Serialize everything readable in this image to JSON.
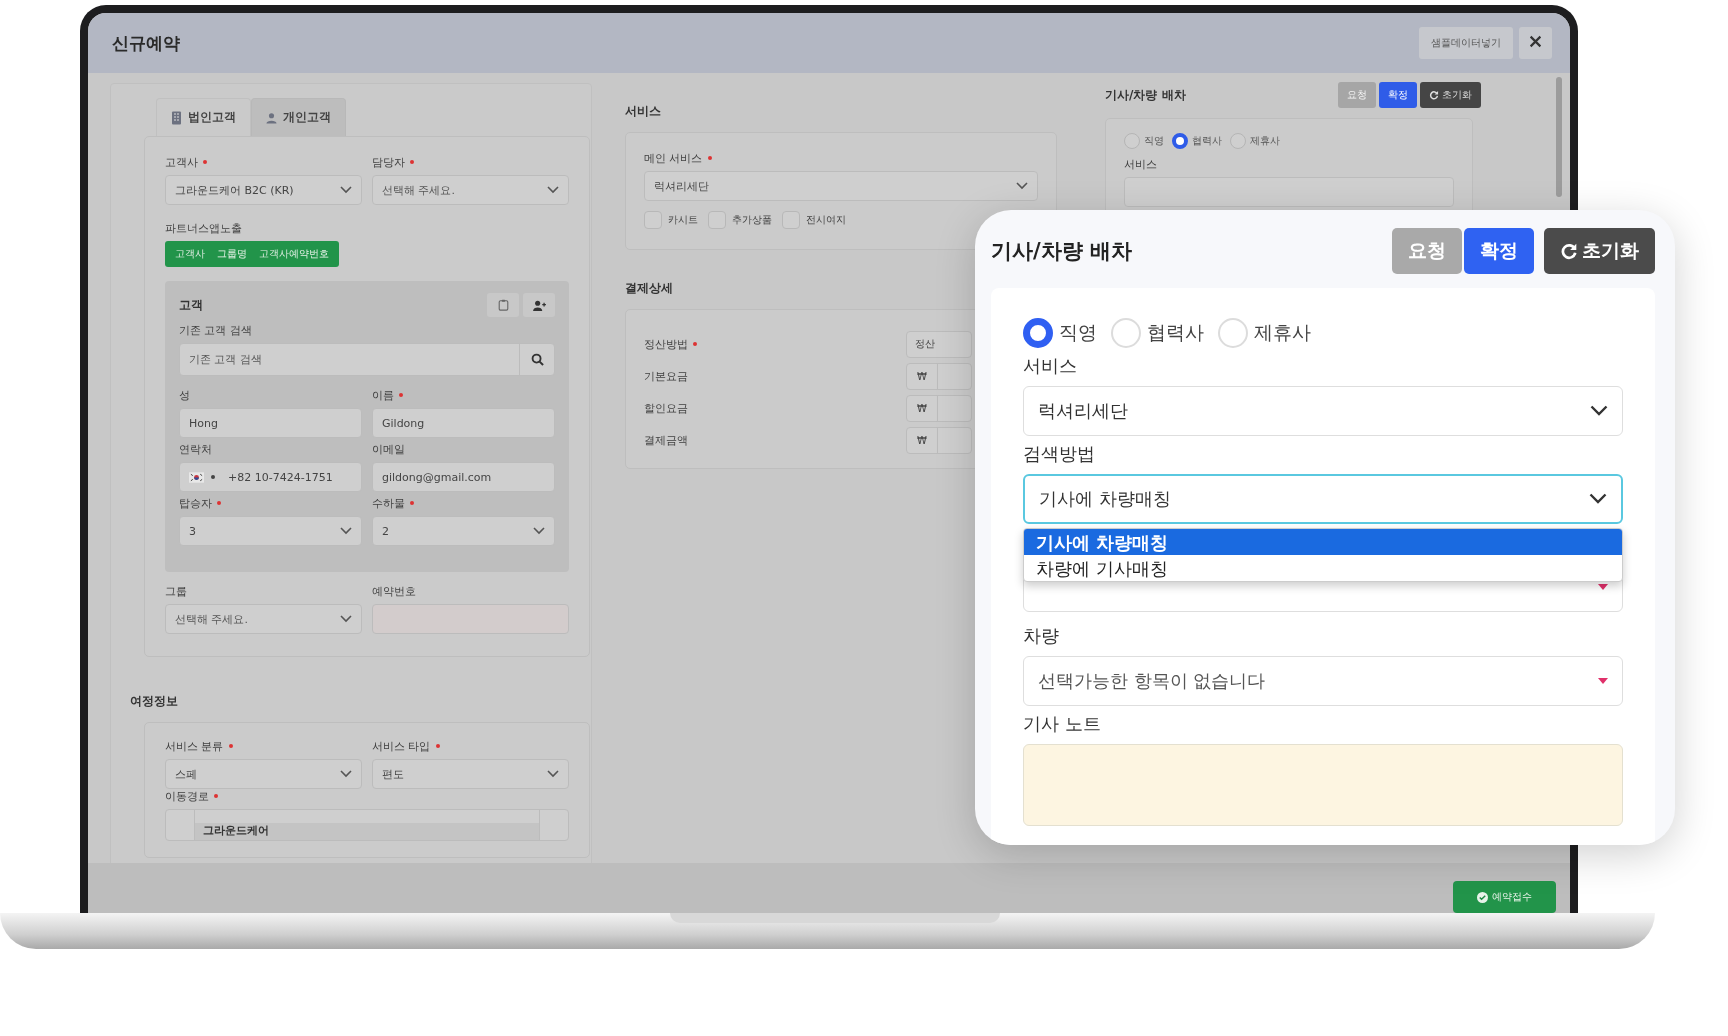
{
  "window": {
    "title": "신규예약",
    "sample_button": "샘플데이터넣기"
  },
  "customer": {
    "tabs": [
      {
        "label": "법인고객",
        "selected": true
      },
      {
        "label": "개인고객",
        "selected": false
      }
    ],
    "fields": [
      {
        "label": "고객사",
        "required": true,
        "kind": "select",
        "value": "그라운드케어 B2C (KR)"
      },
      {
        "label": "담당자",
        "required": true,
        "kind": "select",
        "placeholder": "선택해 주세요."
      }
    ],
    "partner_label": "파트너스앱노출",
    "partner_tags": [
      "고객사",
      "그룹명",
      "고객사예약번호"
    ],
    "customer_box": {
      "title": "고객",
      "search_label": "기존 고객 검색",
      "search_placeholder": "기존 고객 검색",
      "fields": [
        {
          "label": "성",
          "required": false,
          "kind": "input",
          "value": "Hong"
        },
        {
          "label": "이름",
          "required": true,
          "kind": "input",
          "value": "Gildong"
        },
        {
          "label": "연락처",
          "required": false,
          "kind": "phone",
          "value": "+82 10-7424-1751"
        },
        {
          "label": "이메일",
          "required": false,
          "kind": "input",
          "value": "gildong@gmail.com"
        },
        {
          "label": "탑승자",
          "required": true,
          "kind": "select",
          "value": "3"
        },
        {
          "label": "수하물",
          "required": true,
          "kind": "select",
          "value": "2"
        }
      ]
    },
    "extra_fields": [
      {
        "label": "그룹",
        "required": false,
        "kind": "select",
        "placeholder": "선택해 주세요."
      },
      {
        "label": "예약번호",
        "required": false,
        "kind": "readonly"
      }
    ]
  },
  "itinerary": {
    "title": "여정정보",
    "fields": [
      {
        "label": "서비스 분류",
        "required": true,
        "kind": "select",
        "value": "스페"
      },
      {
        "label": "서비스 타입",
        "required": true,
        "kind": "select",
        "value": "편도"
      }
    ],
    "route_label": "이동경로",
    "route_required": true,
    "route_stops": [
      "그라운드케어"
    ]
  },
  "service": {
    "title": "서비스",
    "main_label": "메인 서비스",
    "main_required": true,
    "main_value": "럭셔리세단",
    "options": [
      {
        "label": "카시트",
        "checked": false
      },
      {
        "label": "추가상품",
        "checked": false
      },
      {
        "label": "전시여지",
        "checked": false
      }
    ]
  },
  "payment": {
    "title": "결제상세",
    "rows": [
      {
        "label": "정산방법",
        "required": true,
        "kind": "input",
        "value": "정산"
      },
      {
        "label": "기본요금",
        "required": false,
        "kind": "currency",
        "unit": "₩"
      },
      {
        "label": "할인요금",
        "required": false,
        "kind": "currency",
        "unit": "₩"
      },
      {
        "label": "결제금액",
        "required": false,
        "kind": "currency",
        "unit": "₩"
      }
    ]
  },
  "dispatch": {
    "title": "기사/차량 배차",
    "buttons": [
      {
        "label": "요청",
        "kind": "disabled"
      },
      {
        "label": "확정",
        "kind": "primary"
      },
      {
        "label": "초기화",
        "kind": "reset"
      }
    ],
    "radios": [
      {
        "label": "직영",
        "selected": false
      },
      {
        "label": "협력사",
        "selected": true
      },
      {
        "label": "제휴사",
        "selected": false
      }
    ],
    "service_label": "서비스"
  },
  "submit_button": "예약접수",
  "callout": {
    "title": "기사/차량 배차",
    "buttons": [
      {
        "label": "요청",
        "kind": "disabled"
      },
      {
        "label": "확정",
        "kind": "primary"
      },
      {
        "label": "초기화",
        "kind": "reset"
      }
    ],
    "radios": [
      {
        "label": "직영",
        "selected": true
      },
      {
        "label": "협력사",
        "selected": false
      },
      {
        "label": "제휴사",
        "selected": false
      }
    ],
    "service_label": "서비스",
    "service_value": "럭셔리세단",
    "search_label": "검색방법",
    "search_value": "기사에 차량매칭",
    "search_options": [
      {
        "label": "기사에 차량매칭",
        "selected": true
      },
      {
        "label": "차량에 기사매칭",
        "selected": false
      }
    ],
    "vehicle_label": "차량",
    "vehicle_placeholder": "선택가능한 항목이 없습니다",
    "note_label": "기사 노트"
  }
}
